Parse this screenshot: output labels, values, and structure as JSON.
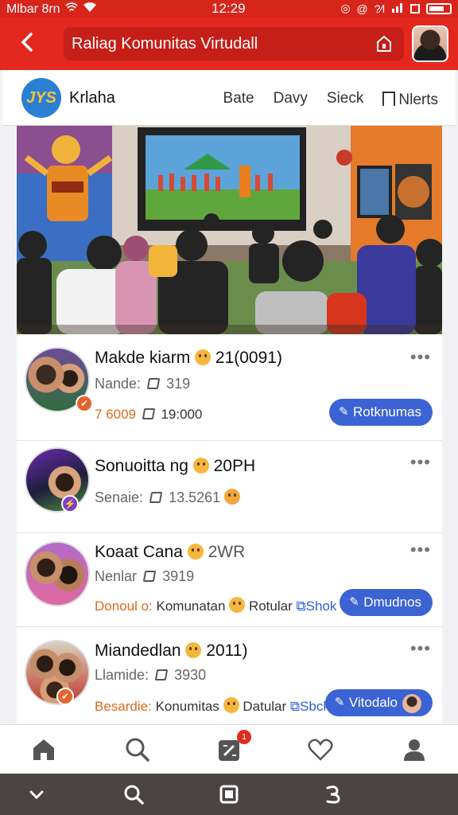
{
  "status_bar": {
    "carrier": "Mlbar 8rn",
    "time": "12:29",
    "right_text": "?⁄l"
  },
  "header": {
    "back_icon": "chevron-left-icon",
    "title": "Raliag Komunitas Virtudall"
  },
  "community": {
    "logo_text": "JYS",
    "name": "Krlaha",
    "tabs": [
      "Bate",
      "Davy",
      "Sieck",
      "Nlerts"
    ]
  },
  "feed": [
    {
      "title": "Makde kiarm",
      "title_suffix": "21(0091)",
      "sub_label": "Nande:",
      "sub_value": "319",
      "meta_accent": "7 6009",
      "meta_value": "19:000",
      "button": "Rotknumas"
    },
    {
      "title": "Sonuoitta ng",
      "title_suffix": "20PH",
      "sub_label": "Senaie:",
      "sub_value": "13.5261",
      "meta_accent": "",
      "meta_value": "",
      "button": ""
    },
    {
      "title": "Koaat Cana",
      "title_suffix": "2WR",
      "sub_label": "Nenlar",
      "sub_value": "3919",
      "meta_accent": "Donoul o:",
      "meta_value": "Komunatan",
      "meta_extra": "Rotular",
      "meta_link": "Shok",
      "button": "Dmudnos"
    },
    {
      "title": "Miandedlan",
      "title_suffix": "2011)",
      "sub_label": "Llamide:",
      "sub_value": "3930",
      "meta_accent": "Besardie:",
      "meta_value": "Konumitas",
      "meta_extra": "Datular",
      "meta_link": "Sbck",
      "button": "Vitodalo"
    }
  ],
  "tabbar": {
    "items": [
      "home-icon",
      "search-icon",
      "edit-icon",
      "heart-icon",
      "person-icon"
    ],
    "notification_count": "1"
  },
  "colors": {
    "brand_red": "#e2281f",
    "button_blue": "#3b63d3",
    "accent_orange": "#e06a1e"
  }
}
